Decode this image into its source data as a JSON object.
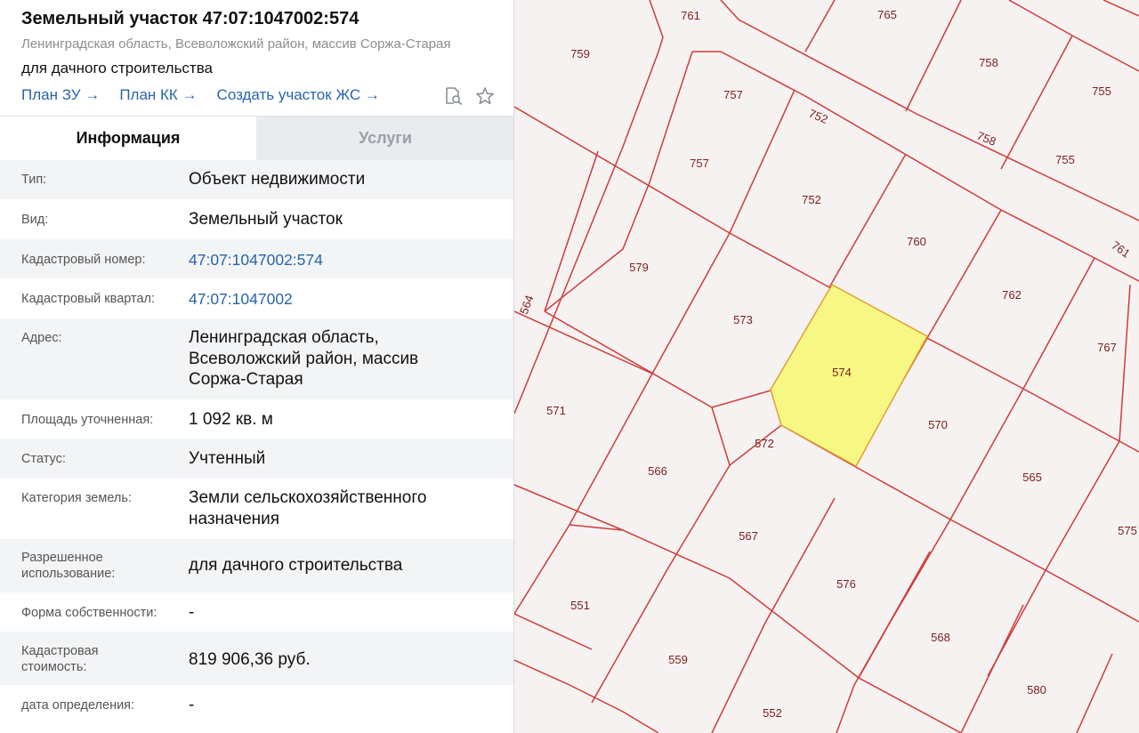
{
  "header": {
    "title": "Земельный участок 47:07:1047002:574",
    "subtitle": "Ленинградская область, Всеволожский район, массив Соржа-Старая",
    "purpose": "для дачного строительства",
    "links": [
      {
        "label": "План ЗУ →"
      },
      {
        "label": "План КК →"
      },
      {
        "label": "Создать участок ЖС →"
      }
    ],
    "icons": [
      "document-search-icon",
      "star-icon"
    ]
  },
  "tabs": [
    {
      "label": "Информация",
      "active": true
    },
    {
      "label": "Услуги",
      "active": false
    }
  ],
  "rows": [
    {
      "label": "Тип:",
      "value": "Объект недвижимости"
    },
    {
      "label": "Вид:",
      "value": "Земельный участок"
    },
    {
      "label": "Кадастровый номер:",
      "value": "47:07:1047002:574",
      "link": true
    },
    {
      "label": "Кадастровый квартал:",
      "value": "47:07:1047002",
      "link": true
    },
    {
      "label": "Адрес:",
      "value_lines": [
        "Ленинградская область,",
        "Всеволожский район, массив",
        "Соржа-Старая"
      ]
    },
    {
      "label": "Площадь уточненная:",
      "value": "1 092 кв. м"
    },
    {
      "label": "Статус:",
      "value": "Учтенный"
    },
    {
      "label": "Категория земель:",
      "value_lines": [
        "Земли сельскохозяйственного",
        "назначения"
      ]
    },
    {
      "label_lines": [
        "Разрешенное",
        "использование:"
      ],
      "value": "для дачного строительства"
    },
    {
      "label": "Форма собственности:",
      "value": "-"
    },
    {
      "label_lines": [
        "Кадастровая",
        "стоимость:"
      ],
      "value": "819 906,36 руб."
    },
    {
      "label": "дата определения:",
      "value": "-"
    }
  ],
  "map": {
    "colors": {
      "background": "#f6f2f1",
      "boundary": "#cf3b3b",
      "selected_fill": "#f7f784",
      "selected_stroke": "#e0a030",
      "label": "#7a1e1e"
    },
    "selected_plot": "574",
    "plot_labels": [
      "761",
      "765",
      "759",
      "758",
      "755",
      "757",
      "752",
      "757",
      "758",
      "755",
      "752",
      "760",
      "761",
      "579",
      "762",
      "564",
      "573",
      "574",
      "767",
      "571",
      "570",
      "572",
      "566",
      "565",
      "567",
      "575",
      "576",
      "551",
      "568",
      "559",
      "580",
      "552"
    ]
  }
}
